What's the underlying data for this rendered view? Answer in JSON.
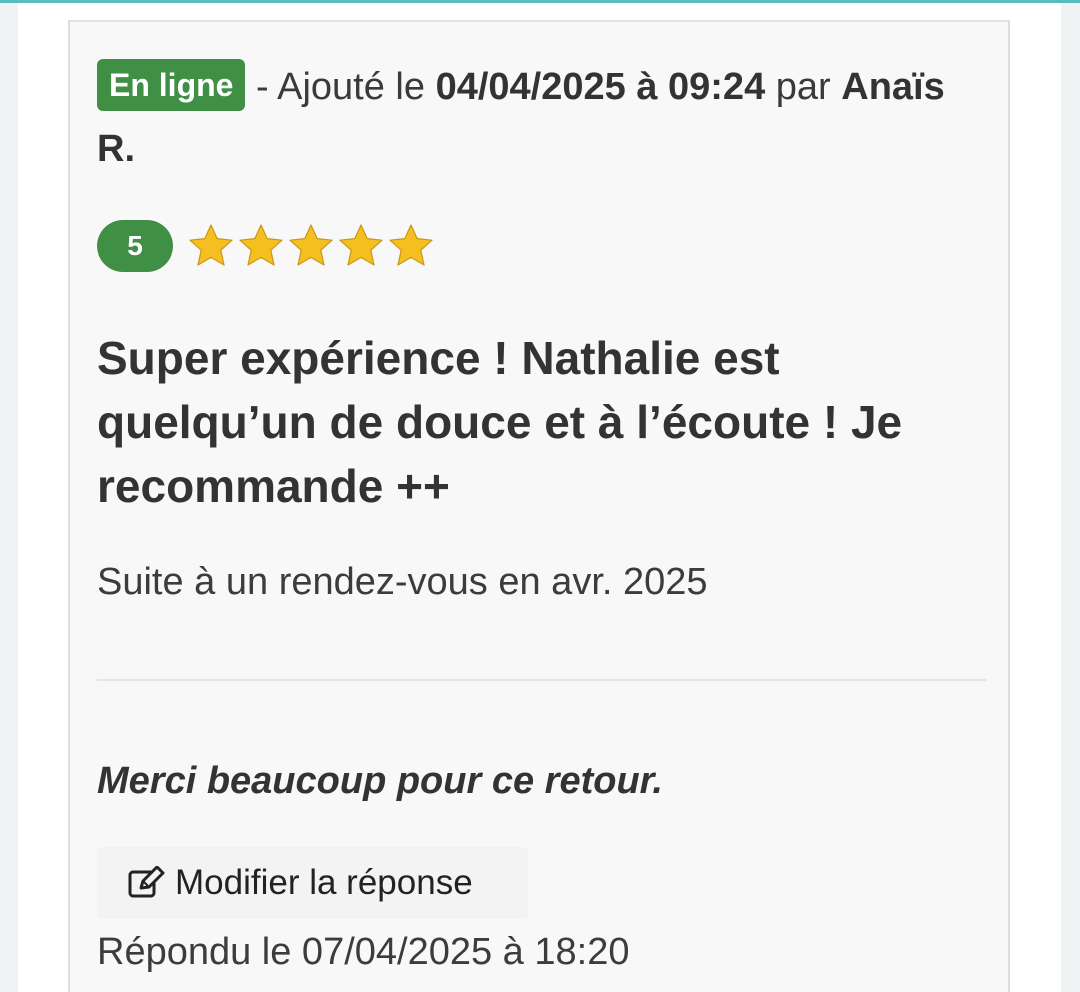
{
  "review": {
    "status_badge": "En ligne",
    "added_prefix": "- Ajouté le",
    "added_datetime": "04/04/2025 à 09:24",
    "by_word": "par",
    "author": "Anaïs R.",
    "rating": "5",
    "stars_filled": 5,
    "stars_total": 5,
    "title": "Super expérience ! Nathalie est quelqu’un de douce et à l’écoute ! Je recommande ++",
    "visit_info": "Suite à un rendez-vous en avr. 2025"
  },
  "reply": {
    "text": "Merci beaucoup pour ce retour.",
    "edit_button_label": "Modifier la réponse",
    "edit_icon": "pencil-square-icon",
    "replied_date": "Répondu le 07/04/2025 à 18:20"
  },
  "colors": {
    "accent_top": "#5bbcc0",
    "status_green": "#3f8f45",
    "star_gold": "#f5bf1f"
  }
}
